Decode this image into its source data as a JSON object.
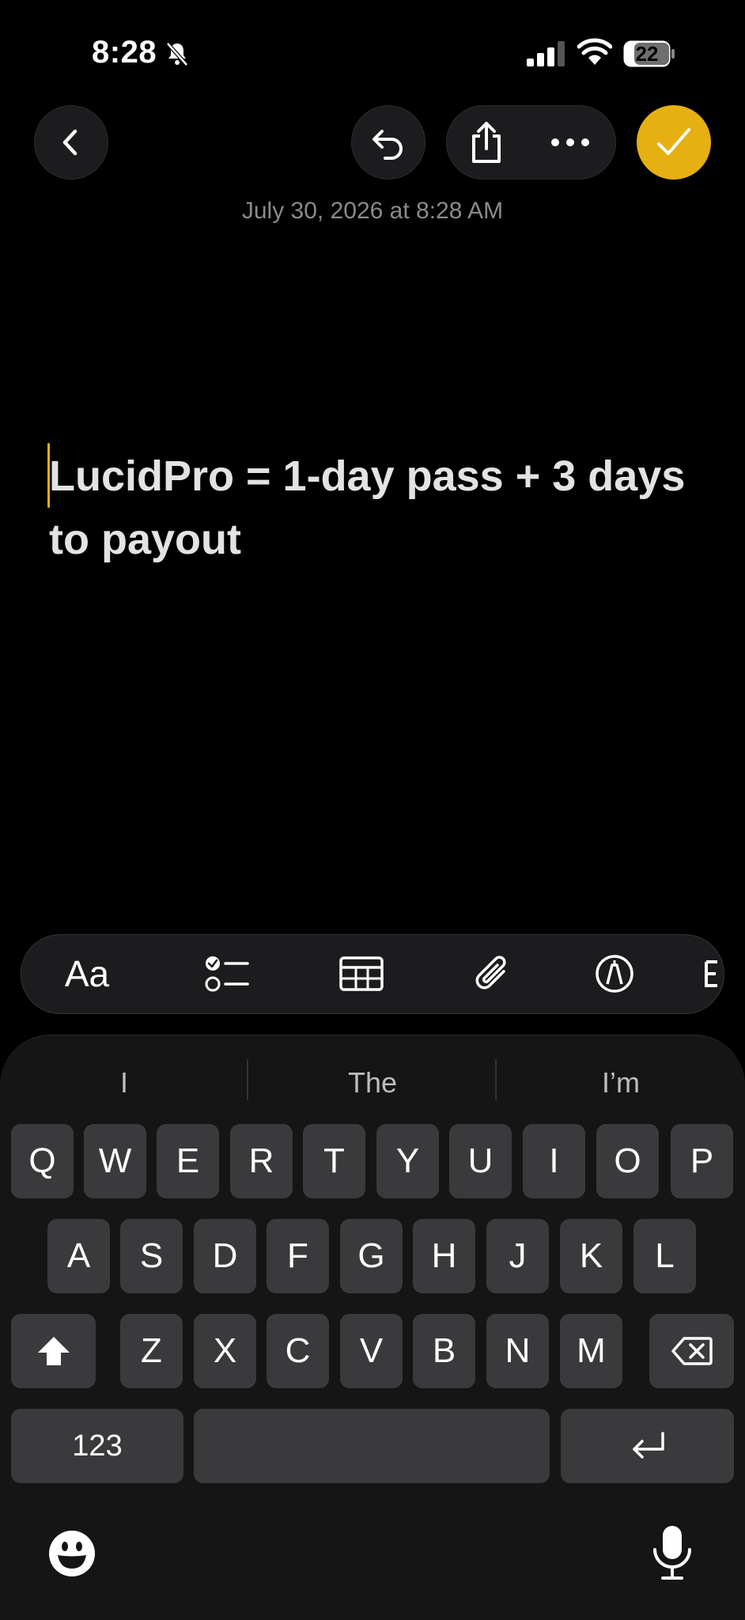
{
  "status_bar": {
    "time": "8:28",
    "battery": "22"
  },
  "note": {
    "date": "July 30, 2026 at 8:28 AM",
    "body": "LucidPro = 1-day pass + 3 days to payout"
  },
  "toolbar": {
    "format_label": "Aa"
  },
  "keyboard": {
    "suggestions": [
      "I",
      "The",
      "I’m"
    ],
    "row1": [
      "Q",
      "W",
      "E",
      "R",
      "T",
      "Y",
      "U",
      "I",
      "O",
      "P"
    ],
    "row2": [
      "A",
      "S",
      "D",
      "F",
      "G",
      "H",
      "J",
      "K",
      "L"
    ],
    "row3": [
      "Z",
      "X",
      "C",
      "V",
      "B",
      "N",
      "M"
    ],
    "numbers_label": "123"
  },
  "colors": {
    "accent": "#e6b012",
    "key": "#3a3a3c",
    "keyboard_bg": "#151515"
  }
}
